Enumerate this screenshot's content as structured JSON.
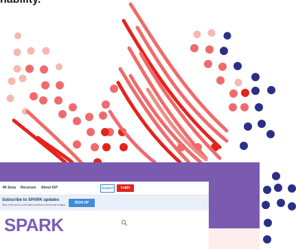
{
  "headline": "nability.",
  "nav": {
    "links": [
      "Mi Sena",
      "Recursos",
      "About IUP"
    ],
    "support_label": "Support",
    "login_label": "Login"
  },
  "subscribe": {
    "title": "Subscribe to SPARK updates",
    "text": "Stay in the know on the latest workforce trends and insights.",
    "button_label": "SIGN UP"
  },
  "brand": "SPARK",
  "icons": {
    "search": "search-icon"
  },
  "colors": {
    "red": "#e2241d",
    "salmon": "#ef6b6b",
    "pink": "#f5b9b1",
    "navy": "#2b2f86",
    "purple": "#7a5bb0",
    "brand_purple": "#7b5fb5",
    "blue_button": "#3f8cd8"
  }
}
